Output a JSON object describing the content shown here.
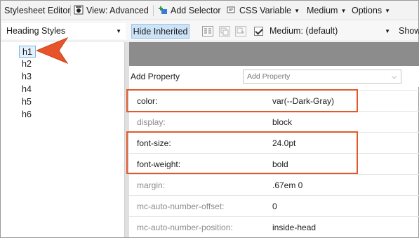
{
  "toolbar": {
    "title": "Stylesheet Editor",
    "view_label": "View: Advanced",
    "add_selector_label": "Add Selector",
    "css_variable_label": "CSS Variable",
    "medium_label": "Medium",
    "options_label": "Options"
  },
  "subtoolbar": {
    "styles_select": "Heading Styles",
    "hide_inherited_label": "Hide Inherited",
    "medium_select": "Medium: (default)",
    "show_label": "Show"
  },
  "tree": {
    "items": [
      {
        "label": "h1",
        "selected": true
      },
      {
        "label": "h2"
      },
      {
        "label": "h3"
      },
      {
        "label": "h4"
      },
      {
        "label": "h5"
      },
      {
        "label": "h6"
      }
    ]
  },
  "panel": {
    "add_property_label": "Add Property",
    "add_property_placeholder": "Add Property",
    "properties": [
      {
        "name": "color:",
        "value": "var(--Dark-Gray)"
      },
      {
        "name": "display:",
        "value": "block"
      },
      {
        "name": "font-size:",
        "value": "24.0pt"
      },
      {
        "name": "font-weight:",
        "value": "bold"
      },
      {
        "name": "margin:",
        "value": ".67em 0"
      },
      {
        "name": "mc-auto-number-offset:",
        "value": "0"
      },
      {
        "name": "mc-auto-number-position:",
        "value": "inside-head"
      }
    ]
  },
  "colors": {
    "highlight": "#e25a2c",
    "selection": "#cde3f7",
    "header_gray": "#8c8c8c"
  }
}
